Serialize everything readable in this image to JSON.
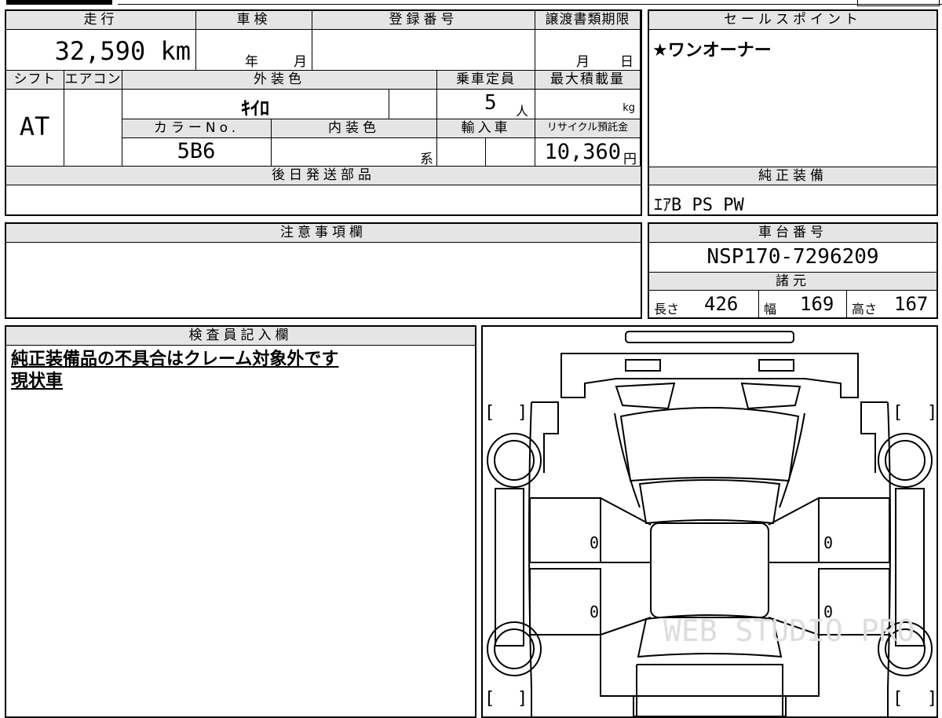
{
  "mileage": {
    "label": "走行",
    "value": "32,590 km"
  },
  "inspection": {
    "label": "車検",
    "year": "年",
    "month": "月"
  },
  "registration": {
    "label": "登録番号",
    "value": ""
  },
  "transfer_deadline": {
    "label": "譲渡書類期限",
    "month": "月",
    "day": "日"
  },
  "sales_point": {
    "label": "セールスポイント",
    "value": "★ワンオーナー"
  },
  "shift": {
    "label": "シフト",
    "value": "AT"
  },
  "aircon": {
    "label": "エアコン",
    "value": ""
  },
  "exterior_color": {
    "label": "外装色",
    "value": "ｷｲﾛ"
  },
  "capacity": {
    "label": "乗車定員",
    "value": "5",
    "unit": "人"
  },
  "max_load": {
    "label": "最大積載量",
    "unit": "kg"
  },
  "color_no": {
    "label": "カラーNo.",
    "value": "5B6"
  },
  "interior_color": {
    "label": "内装色",
    "suffix": "系"
  },
  "import": {
    "label": "輸入車"
  },
  "recycle": {
    "label": "リサイクル預託金",
    "value": "10,360",
    "unit": "円"
  },
  "later_parts": {
    "label": "後日発送部品",
    "value": ""
  },
  "genuine_equipment": {
    "label": "純正装備",
    "value": "ｴｱB PS PW"
  },
  "notes": {
    "label": "注意事項欄",
    "value": ""
  },
  "chassis": {
    "label": "車台番号",
    "value": "NSP170-7296209"
  },
  "specs": {
    "label": "諸元",
    "length_label": "長さ",
    "length": "426",
    "width_label": "幅",
    "width": "169",
    "height_label": "高さ",
    "height": "167"
  },
  "inspector": {
    "label": "検査員記入欄",
    "line1": "純正装備品の不具合はクレーム対象外です",
    "line2": "現状車"
  },
  "diagram": {
    "marks": [
      "0",
      "0",
      "0",
      "0"
    ],
    "watermark": "WEB STUDIO PRO"
  }
}
